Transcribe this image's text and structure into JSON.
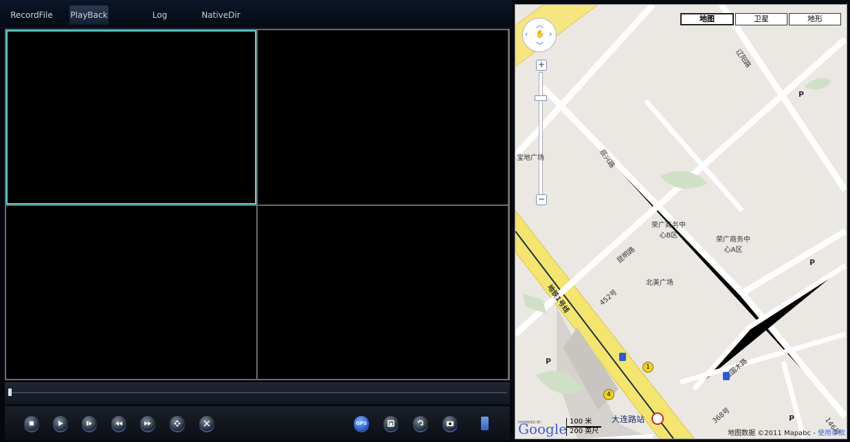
{
  "tabs": [
    {
      "label": "RecordFile"
    },
    {
      "label": "PlayBack",
      "active": true
    },
    {
      "label": "Log"
    },
    {
      "label": "NativeDir"
    }
  ],
  "map": {
    "types": [
      "地图",
      "卫星",
      "地形"
    ],
    "labels": {
      "road1": "辽阳路",
      "road2": "宝地广场",
      "road3": "辰兴路",
      "road4": "昆明路",
      "road5": "452号",
      "road6": "荣广商务中心B区",
      "road7": "荣广商务中心A区",
      "road8": "北美广场",
      "road9": "地铁1号线",
      "road10": "唐国木路",
      "road11": "368号",
      "road12": "146号"
    },
    "station": "大连路站",
    "scale_m": "100 米",
    "scale_ft": "200 英尺",
    "copyright": "地图数据 ©2011 Mapabc - ",
    "terms": "使用条款",
    "powered": "POWERED BY",
    "google": "Google",
    "parking": "P"
  },
  "icons": [
    "stop-icon",
    "play-icon",
    "step-icon",
    "rewind-icon",
    "fast-forward-icon",
    "move-icon",
    "cut-icon",
    "gps-icon",
    "record-icon",
    "sound-icon",
    "capture-icon",
    "doc-icon"
  ]
}
